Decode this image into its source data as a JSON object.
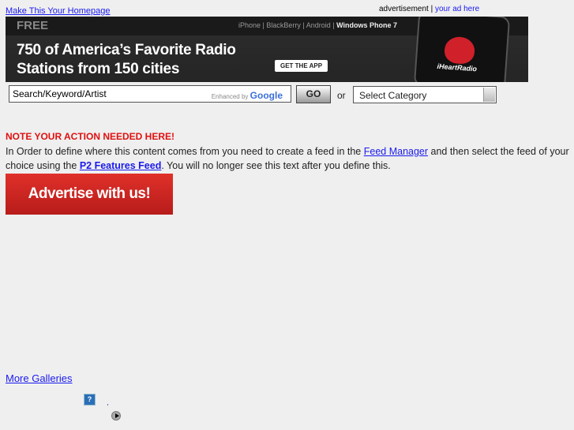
{
  "header": {
    "homepage_link": "Make This Your Homepage",
    "ad_label": "advertisement",
    "ad_sep": "|",
    "your_ad": "your ad here"
  },
  "banner": {
    "free": "FREE",
    "platforms": "iPhone | BlackBerry | Android |",
    "platform_bold": "Windows Phone 7",
    "headline1": "750 of America’s Favorite Radio",
    "headline2": "Stations from 150 cities",
    "cta": "GET THE APP",
    "logo": "iHeartRadio"
  },
  "search": {
    "value": "Search/Keyword/Artist",
    "enhanced": "Enhanced by",
    "google": "Google",
    "go": "GO",
    "or": "or",
    "category": "Select Category"
  },
  "notice": {
    "title": "NOTE YOUR ACTION NEEDED HERE!",
    "text1": "In Order to define where this content comes from you need to create a feed in the ",
    "link1": "Feed Manager",
    "text2": " and then select the feed of your choice using the ",
    "link2": "P2 Features Feed",
    "text3": ". You will no longer see this text after you define this."
  },
  "advertise": "Advertise with us!",
  "more_galleries": "More Galleries",
  "icons": {
    "help": "?"
  }
}
